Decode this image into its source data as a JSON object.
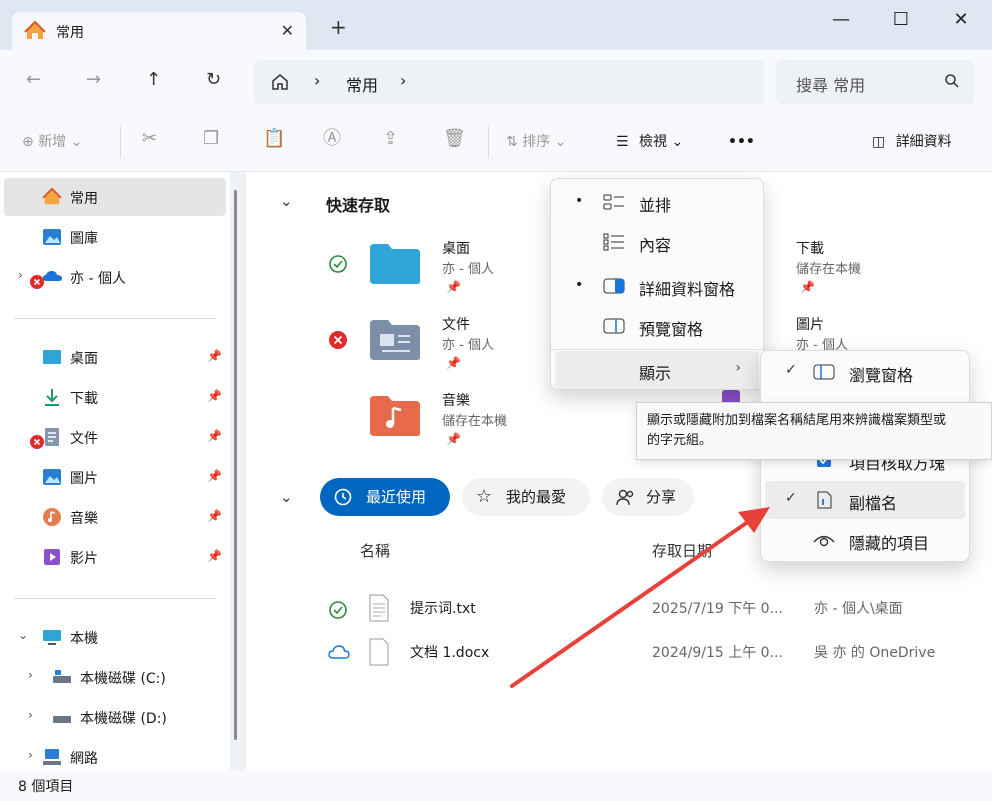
{
  "window": {
    "tab_title": "常用",
    "tab_close": "✕",
    "new_tab": "+",
    "minimize": "—",
    "maximize": "☐",
    "close": "✕"
  },
  "nav": {
    "back": "←",
    "forward": "→",
    "up": "↑",
    "refresh": "↻",
    "breadcrumb": [
      "常用"
    ],
    "search_placeholder": "搜尋 常用"
  },
  "toolbar": {
    "new_label": "新增",
    "sort_label": "排序",
    "view_label": "檢視",
    "more_label": "•••",
    "details_label": "詳細資料"
  },
  "sidebar": {
    "items": [
      {
        "label": "常用",
        "icon": "home-icon",
        "selected": true
      },
      {
        "label": "圖庫",
        "icon": "gallery-icon"
      },
      {
        "label": "亦 - 個人",
        "icon": "onedrive-icon",
        "error": true
      }
    ],
    "pinned": [
      {
        "label": "桌面",
        "icon": "desktop-icon"
      },
      {
        "label": "下載",
        "icon": "download-icon"
      },
      {
        "label": "文件",
        "icon": "documents-icon",
        "error": true
      },
      {
        "label": "圖片",
        "icon": "pictures-icon"
      },
      {
        "label": "音樂",
        "icon": "music-icon"
      },
      {
        "label": "影片",
        "icon": "videos-icon"
      }
    ],
    "this_pc": {
      "label": "本機"
    },
    "drives": [
      {
        "label": "本機磁碟 (C:)"
      },
      {
        "label": "本機磁碟 (D:)"
      }
    ],
    "network": {
      "label": "網路"
    }
  },
  "quick_access": {
    "title": "快速存取",
    "items": [
      {
        "name": "桌面",
        "sub": "亦 - 個人",
        "status": "synced",
        "color": "#2ea6d8"
      },
      {
        "name": "文件",
        "sub": "亦 - 個人",
        "status": "error",
        "color": "#7d8fa8"
      },
      {
        "name": "音樂",
        "sub": "儲存在本機",
        "status": "",
        "color": "#e76b4a"
      },
      {
        "name": "下載",
        "sub": "儲存在本機",
        "status": "",
        "color": "#2eaf8c"
      },
      {
        "name": "圖片",
        "sub": "亦 - 個人",
        "status": "",
        "color": "#2a8ad4"
      }
    ]
  },
  "recent": {
    "tabs": [
      {
        "label": "最近使用",
        "active": true
      },
      {
        "label": "我的最愛"
      },
      {
        "label": "分享"
      }
    ],
    "columns": [
      "名稱",
      "存取日期"
    ],
    "rows": [
      {
        "name": "提示词.txt",
        "date": "2025/7/19 下午 0...",
        "location": "亦 - 個人\\桌面",
        "status": "synced"
      },
      {
        "name": "文档 1.docx",
        "date": "2024/9/15 上午 0...",
        "location": "吳 亦 的 OneDrive",
        "status": "cloud"
      }
    ]
  },
  "view_menu": {
    "items": [
      {
        "label": "並排",
        "bullet": true
      },
      {
        "label": "內容",
        "bullet": false
      },
      {
        "label": "詳細資料窗格",
        "bullet": true
      },
      {
        "label": "預覽窗格",
        "bullet": false
      },
      {
        "label": "顯示",
        "submenu": true
      }
    ]
  },
  "show_submenu": {
    "items": [
      {
        "label": "瀏覽窗格",
        "checked": true
      },
      {
        "label": "項目核取方塊",
        "checked": true
      },
      {
        "label": "副檔名",
        "checked": true
      },
      {
        "label": "隱藏的項目",
        "checked": false
      }
    ]
  },
  "tooltip": {
    "line1": "顯示或隱藏附加到檔案名稱結尾用來辨識檔案類型或",
    "line2": "的字元組。"
  },
  "status": {
    "item_count": "8 個項目"
  },
  "colors": {
    "accent": "#0067c0",
    "arrow": "#e8403a",
    "error": "#e02a2a",
    "synced": "#2e8b3a"
  }
}
